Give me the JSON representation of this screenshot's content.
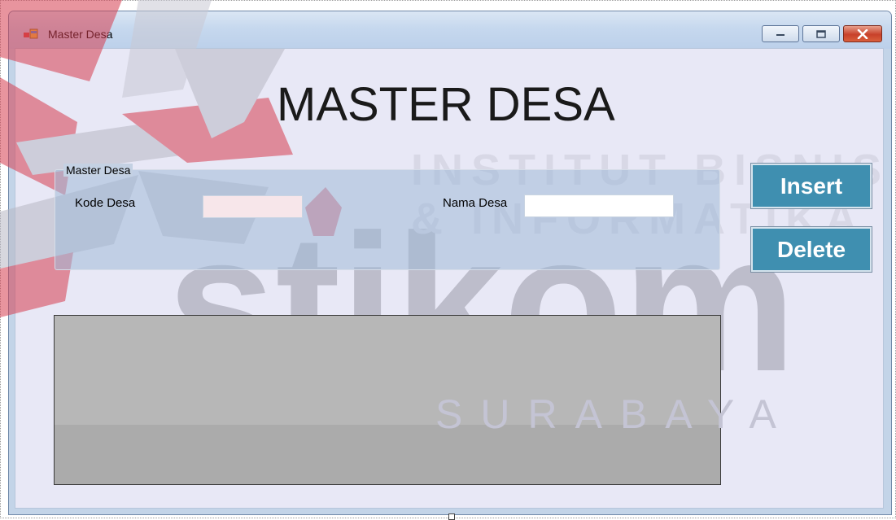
{
  "window": {
    "title": "Master Desa",
    "controls": {
      "minimize": "minimize",
      "maximize": "maximize",
      "close": "close"
    }
  },
  "form": {
    "heading": "MASTER DESA",
    "group_label": "Master Desa",
    "fields": {
      "kode_desa": {
        "label": "Kode Desa",
        "value": ""
      },
      "nama_desa": {
        "label": "Nama Desa",
        "value": ""
      }
    },
    "buttons": {
      "insert": "Insert",
      "delete": "Delete"
    }
  },
  "watermark": {
    "line1": "INSTITUT BISNIS",
    "line2": "& INFORMATIKA",
    "brand": "stikom",
    "city": "SURABAYA"
  },
  "colors": {
    "button_bg": "#3f8fb0",
    "client_bg": "#e8e8f6",
    "grid_bg": "#ababab",
    "logo_red": "#d63e50",
    "logo_gray": "#9a9aa8"
  }
}
